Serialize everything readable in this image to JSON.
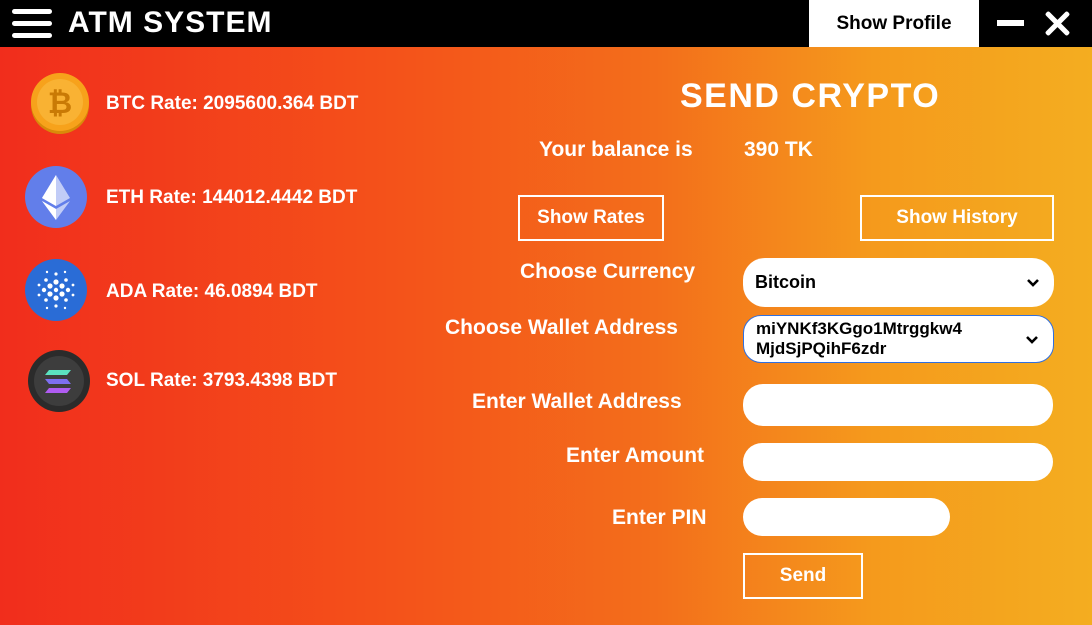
{
  "titlebar": {
    "app_title": "ATM SYSTEM",
    "show_profile_label": "Show Profile"
  },
  "rates": [
    {
      "icon": "bitcoin-icon",
      "text": "BTC Rate: 2095600.364 BDT"
    },
    {
      "icon": "ethereum-icon",
      "text": "ETH Rate: 144012.4442 BDT"
    },
    {
      "icon": "cardano-icon",
      "text": "ADA Rate: 46.0894 BDT"
    },
    {
      "icon": "solana-icon",
      "text": "SOL Rate: 3793.4398 BDT"
    }
  ],
  "form": {
    "heading": "SEND CRYPTO",
    "balance_label": "Your balance is",
    "balance_value": "390 TK",
    "show_rates_label": "Show Rates",
    "show_history_label": "Show History",
    "currency_label": "Choose Currency",
    "currency_value": "Bitcoin",
    "wallet_choice_label": "Choose Wallet Address",
    "wallet_choice_line1": "miYNKf3KGgo1Mtrggkw4",
    "wallet_choice_line2": "MjdSjPQihF6zdr",
    "wallet_input_label": "Enter Wallet Address",
    "wallet_input_value": "",
    "amount_label": "Enter Amount",
    "amount_value": "",
    "pin_label": "Enter PIN",
    "pin_value": "",
    "send_label": "Send"
  },
  "colors": {
    "gradient_left": "#f12d1c",
    "gradient_right": "#f4ad20",
    "titlebar": "#000000"
  }
}
